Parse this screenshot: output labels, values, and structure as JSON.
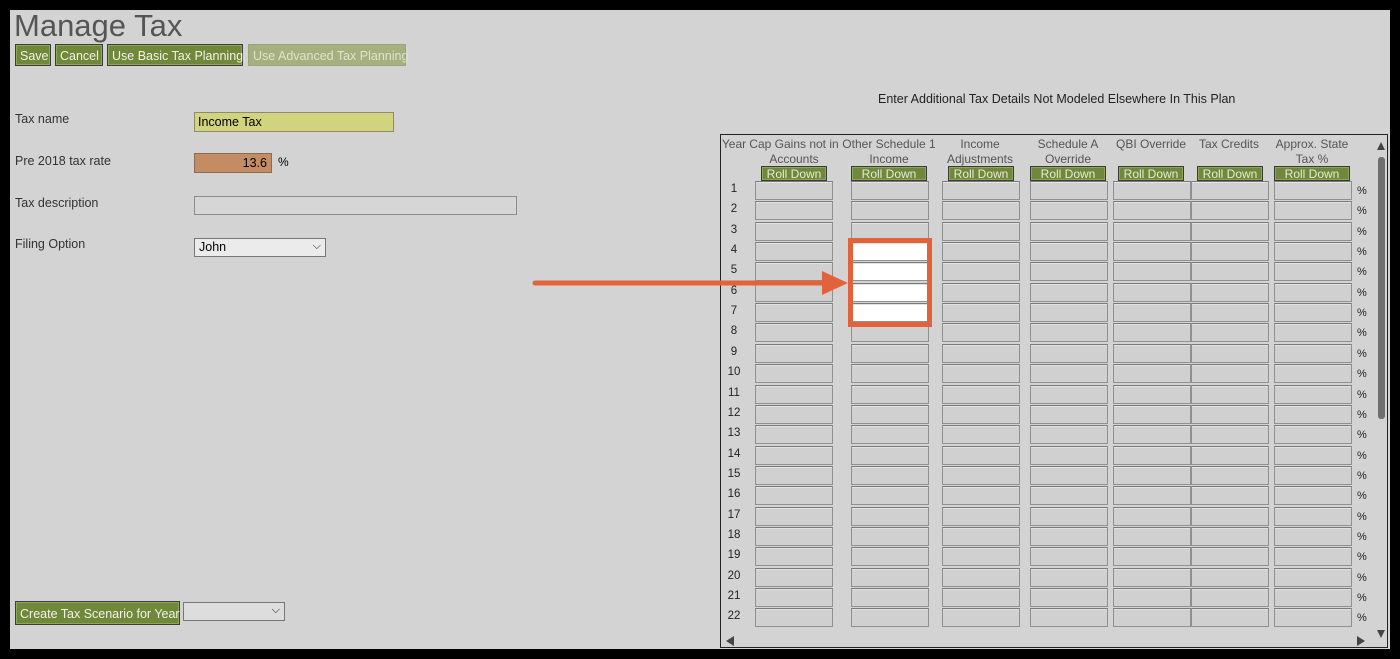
{
  "page": {
    "title": "Manage Tax",
    "buttons": {
      "save": "Save",
      "cancel": "Cancel",
      "basic": "Use Basic Tax Planning",
      "advanced": "Use Advanced Tax Planning"
    }
  },
  "form": {
    "tax_name_label": "Tax name",
    "tax_name_value": "Income Tax",
    "pre2018_label": "Pre 2018 tax rate",
    "pre2018_value": "13.6",
    "pre2018_unit": "%",
    "description_label": "Tax description",
    "description_value": "",
    "filing_label": "Filing Option",
    "filing_value": "John"
  },
  "scenario": {
    "button": "Create Tax Scenario for Year",
    "year_value": ""
  },
  "grid": {
    "caption": "Enter Additional Tax Details Not Modeled Elsewhere In This Plan",
    "year_header": "Year",
    "roll_down": "Roll Down",
    "pct_symbol": "%",
    "columns": [
      {
        "line1": "Cap Gains not in",
        "line2": "Accounts"
      },
      {
        "line1": "Other Schedule 1",
        "line2": "Income"
      },
      {
        "line1": "Income",
        "line2": "Adjustments"
      },
      {
        "line1": "Schedule A",
        "line2": "Override"
      },
      {
        "line1": "QBI Override",
        "line2": ""
      },
      {
        "line1": "Tax Credits",
        "line2": ""
      },
      {
        "line1": "Approx. State",
        "line2": "Tax %"
      }
    ],
    "rows": [
      "1",
      "2",
      "3",
      "4",
      "5",
      "6",
      "7",
      "8",
      "9",
      "10",
      "11",
      "12",
      "13",
      "14",
      "15",
      "16",
      "17",
      "18",
      "19",
      "20",
      "21",
      "22"
    ],
    "highlighted_column": 1,
    "highlighted_rows": [
      4,
      5,
      6,
      7
    ]
  },
  "colors": {
    "button_green": "#70883a",
    "tax_name_bg": "#d1d37e",
    "rate_bg": "#c48c62",
    "annotation": "#e2623c"
  }
}
